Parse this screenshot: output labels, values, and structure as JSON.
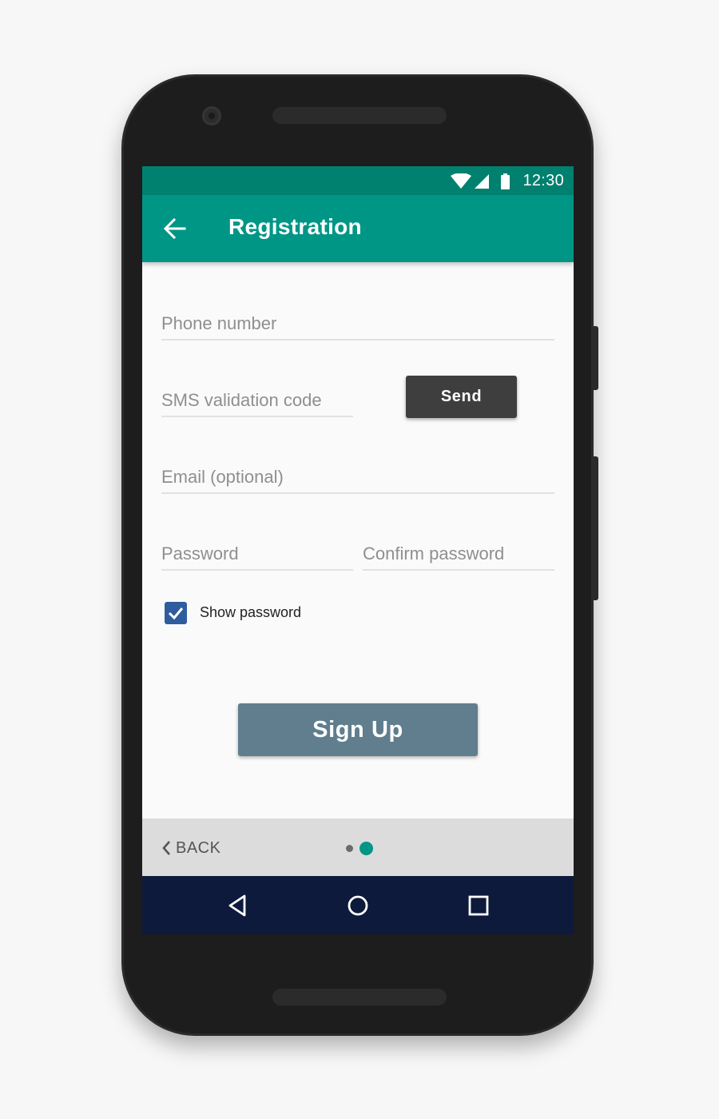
{
  "status_bar": {
    "time": "12:30",
    "icons": [
      "wifi-icon",
      "signal-icon",
      "battery-icon"
    ]
  },
  "app_bar": {
    "title": "Registration",
    "back_icon": "arrow-back-icon"
  },
  "form": {
    "phone_placeholder": "Phone number",
    "sms_placeholder": "SMS validation code",
    "send_label": "Send",
    "email_placeholder": "Email (optional)",
    "password_placeholder": "Password",
    "confirm_placeholder": "Confirm password",
    "show_password_label": "Show password",
    "show_password_checked": true,
    "signup_label": "Sign Up"
  },
  "pager": {
    "back_label": "BACK",
    "pages": 2,
    "current_page": 2
  },
  "nav_bar": {
    "buttons": [
      "nav-back-icon",
      "nav-home-icon",
      "nav-recents-icon"
    ]
  },
  "colors": {
    "status_bar": "#00806f",
    "app_bar": "#009686",
    "send_button": "#3e3e3e",
    "signup_button": "#607e8d",
    "checkbox": "#2f5c9e",
    "nav_bar": "#0d1a3b",
    "pager_bar": "#dcdcdc"
  }
}
